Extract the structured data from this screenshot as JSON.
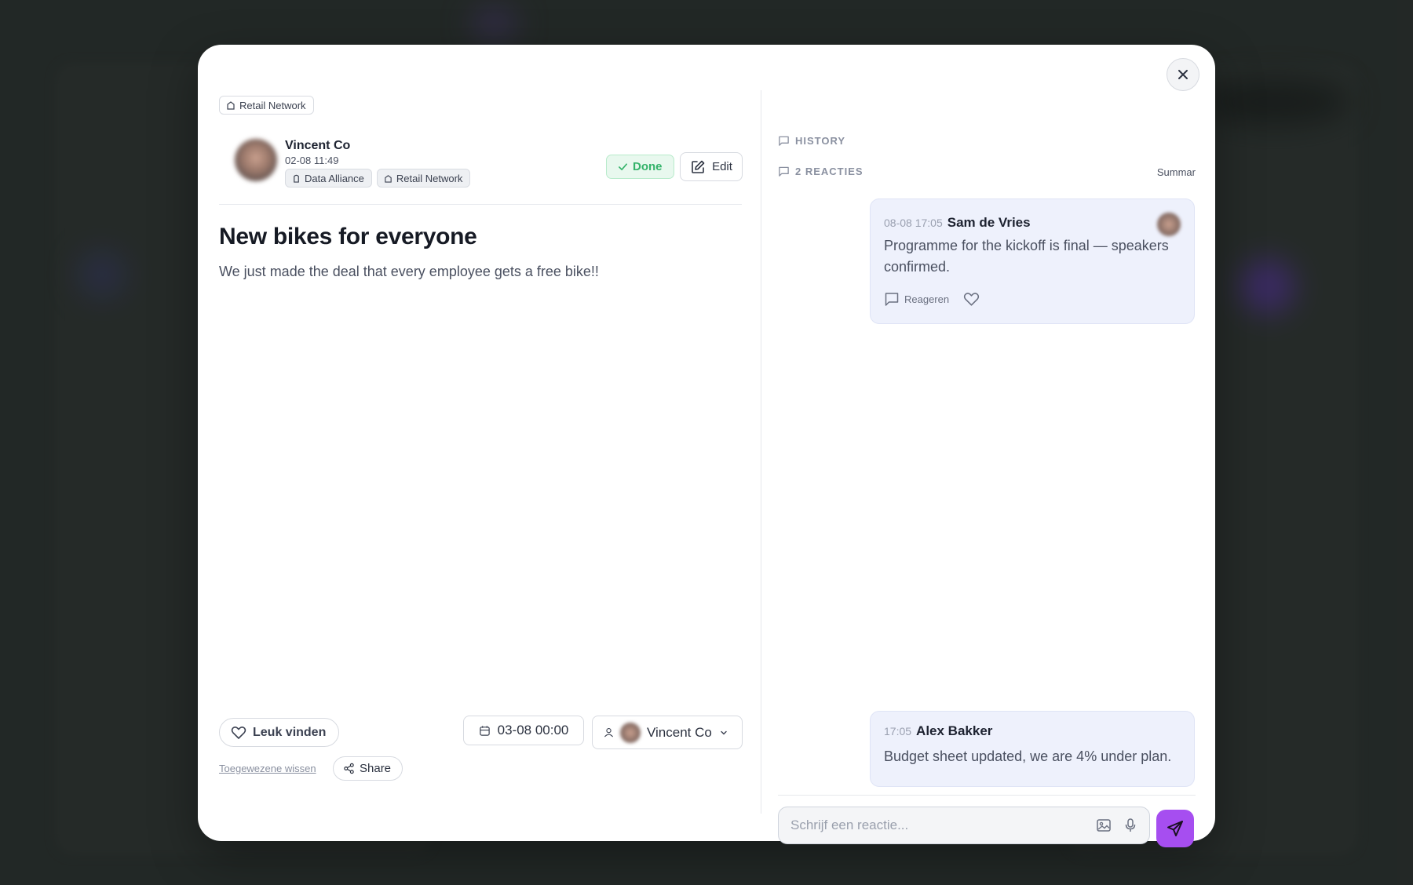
{
  "post": {
    "top_tag": "Retail Network",
    "author_name": "Vincent Co",
    "author_time": "02-08 11:49",
    "author_tags": [
      "Data Alliance",
      "Retail Network"
    ],
    "status": "Done",
    "edit_label": "Edit",
    "title": "New bikes for everyone",
    "body": "We just made the deal that every employee gets a free bike!!",
    "like_label": "Leuk vinden",
    "due_date": "03-08 00:00",
    "assignee": "Vincent Co",
    "clear_assignees_label": "Toegewezene wissen",
    "share_label": "Share"
  },
  "sidebar": {
    "history_label": "HISTORY",
    "reactions_label": "2 REACTIES",
    "summary_label": "Summar"
  },
  "comments": [
    {
      "time": "08-08 17:05",
      "author": "Sam de Vries",
      "text": "Programme for the kickoff is final — speakers confirmed.",
      "reply_label": "Reageren"
    },
    {
      "time": "17:05",
      "author": "Alex Bakker",
      "text": "Budget sheet updated, we are 4% under plan."
    }
  ],
  "reply_input": {
    "placeholder": "Schrijf een reactie...",
    "value": ""
  },
  "colors": {
    "accent": "#a64ef0",
    "done_green": "#34b36a",
    "comment_bg": "#eef1fc"
  },
  "icons": [
    "building-icon",
    "check-icon",
    "edit-icon",
    "heart-icon",
    "calendar-icon",
    "user-icon",
    "chevron-down-icon",
    "share-icon",
    "message-icon",
    "image-icon",
    "mic-icon",
    "send-icon",
    "close-icon"
  ]
}
